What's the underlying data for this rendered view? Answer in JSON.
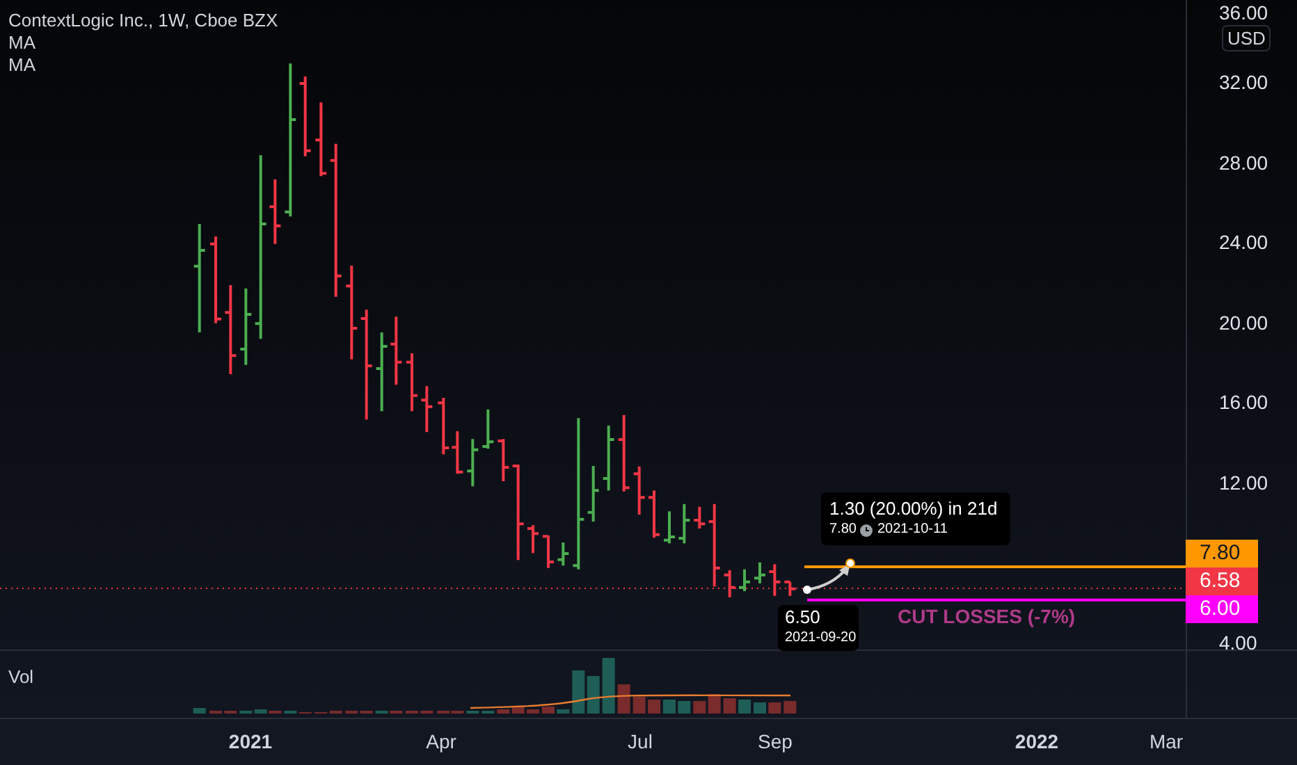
{
  "header": {
    "title": "ContextLogic Inc., 1W, Cboe BZX",
    "indicators": [
      "MA",
      "MA"
    ]
  },
  "price_axis": {
    "currency": "USD",
    "ticks": [
      "36.00",
      "32.00",
      "28.00",
      "24.00",
      "20.00",
      "16.00",
      "12.00",
      "4.00"
    ]
  },
  "price_labels": [
    {
      "text": "7.80",
      "color": "#ff9800"
    },
    {
      "text": "6.58",
      "color": "#f23645"
    },
    {
      "text": "6.00",
      "color": "#ff00ff"
    }
  ],
  "measure": {
    "change": "1.30 (20.00%) in 21d",
    "target_price": "7.80",
    "target_date": "2021-10-11",
    "start_price": "6.50",
    "start_date": "2021-09-20"
  },
  "stop_line": {
    "label": "CUT LOSSES (-7%)"
  },
  "volume_pane": {
    "label": "Vol"
  },
  "time_axis": [
    "2021",
    "Apr",
    "Jul",
    "Sep",
    "2022",
    "Mar"
  ]
}
